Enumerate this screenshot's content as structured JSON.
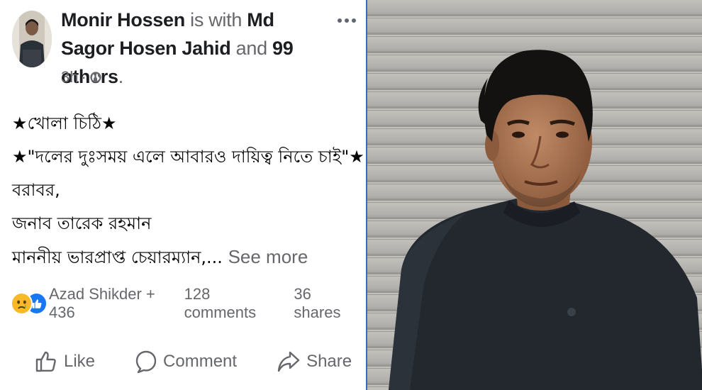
{
  "post": {
    "author": "Monir Hossen",
    "with_text": "is with",
    "tagged": "Md Sagor Hosen Jahid",
    "and_text": "and",
    "others": "99 others",
    "period": ".",
    "time": "3h",
    "separator": "·",
    "body": {
      "line1": "★খোলা চিঠি★",
      "line2": "★\"দলের দুঃসময় এলে আবারও দায়িত্ব নিতে চাই\"★",
      "line3": "বরাবর,",
      "line4": "জনাব তারেক রহমান",
      "line5": "মাননীয় ভারপ্রাপ্ত চেয়ারম্যান,...",
      "see_more": "See more"
    },
    "reactions": {
      "names": "Azad Shikder + 436",
      "comments": "128 comments",
      "shares": "36 shares"
    },
    "actions": {
      "like": "Like",
      "comment": "Comment",
      "share": "Share"
    }
  },
  "icons": [
    "avatar",
    "more-icon",
    "globe-icon",
    "sad-reaction-icon",
    "like-reaction-icon",
    "thumbs-up-icon",
    "comment-icon",
    "share-icon"
  ],
  "colors": {
    "like_blue": "#1877f2",
    "sad_yellow": "#f7b928",
    "secondary_text": "#65676b",
    "photo_border": "#2d6fc6"
  }
}
